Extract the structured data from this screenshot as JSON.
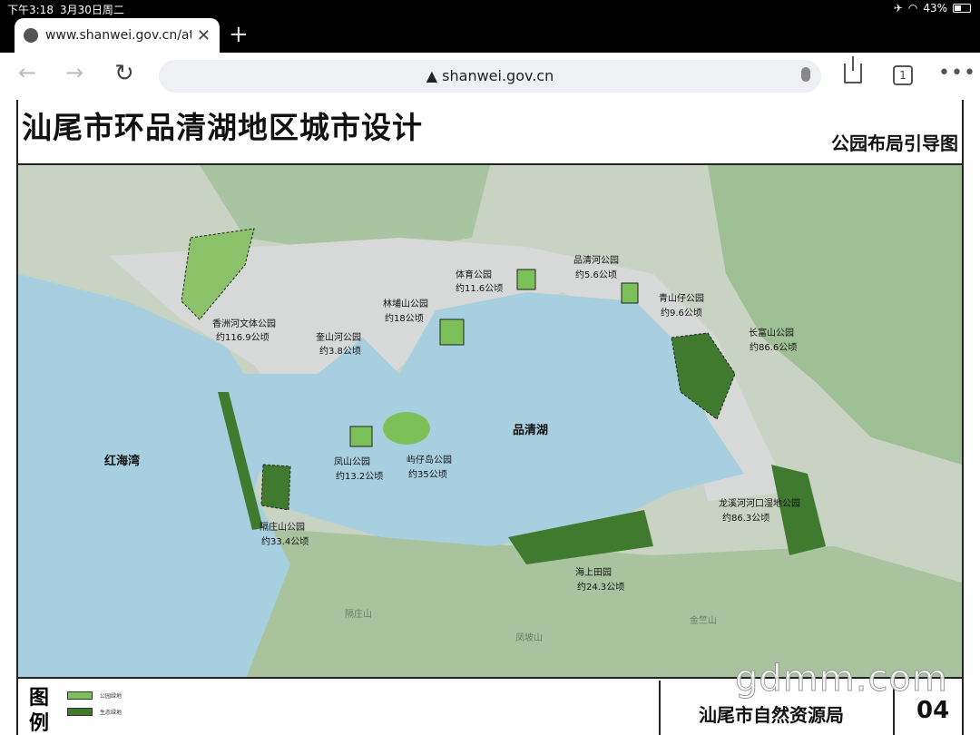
{
  "status_bar": {
    "time": "下午3:18",
    "date": "3月30日周二",
    "battery": "43%"
  },
  "tab": {
    "title": "www.shanwei.gov.cn/atta",
    "close": "✕"
  },
  "toolbar": {
    "url": "▲ shanwei.gov.cn",
    "tab_count": "1",
    "menu": "•••"
  },
  "document": {
    "title": "汕尾市环品清湖地区城市设计",
    "subtitle": "公园布局引导图",
    "legend_title": "图例",
    "legend": [
      {
        "label": "公园绿地",
        "color": "#7cc05a"
      },
      {
        "label": "生态绿地",
        "color": "#3f7a2e"
      }
    ],
    "agency": "汕尾市自然资源局",
    "page_number": "04"
  },
  "map_labels": {
    "hongjiao": "红海湾",
    "pinqing_lake": "品清湖",
    "parks": [
      {
        "name": "品清河公园",
        "area": "约5.6公顷"
      },
      {
        "name": "体育公园",
        "area": "约11.6公顷"
      },
      {
        "name": "林埔山公园",
        "area": "约18公顷"
      },
      {
        "name": "奎山河公园",
        "area": "约3.8公顷"
      },
      {
        "name": "香洲河文体公园",
        "area": "约116.9公顷"
      },
      {
        "name": "青山仔公园",
        "area": "约9.6公顷"
      },
      {
        "name": "长富山公园",
        "area": "约86.6公顷"
      },
      {
        "name": "凤山公园",
        "area": "约13.2公顷"
      },
      {
        "name": "屿仔岛公园",
        "area": "约35公顷"
      },
      {
        "name": "隔庄山公园",
        "area": "约33.4公顷"
      },
      {
        "name": "海上田园",
        "area": "约24.3公顷"
      },
      {
        "name": "龙溪河河口湿地公园",
        "area": "约86.3公顷"
      }
    ],
    "terrain": [
      "隔庄山",
      "凤坡山",
      "金竺山"
    ]
  },
  "colors": {
    "water": "#a7cfe0",
    "urban": "#d7d9d8",
    "hills": "#a9c4a0",
    "park": "#7cc05a",
    "eco": "#3f7a2e"
  },
  "watermark": "gdmm.com"
}
